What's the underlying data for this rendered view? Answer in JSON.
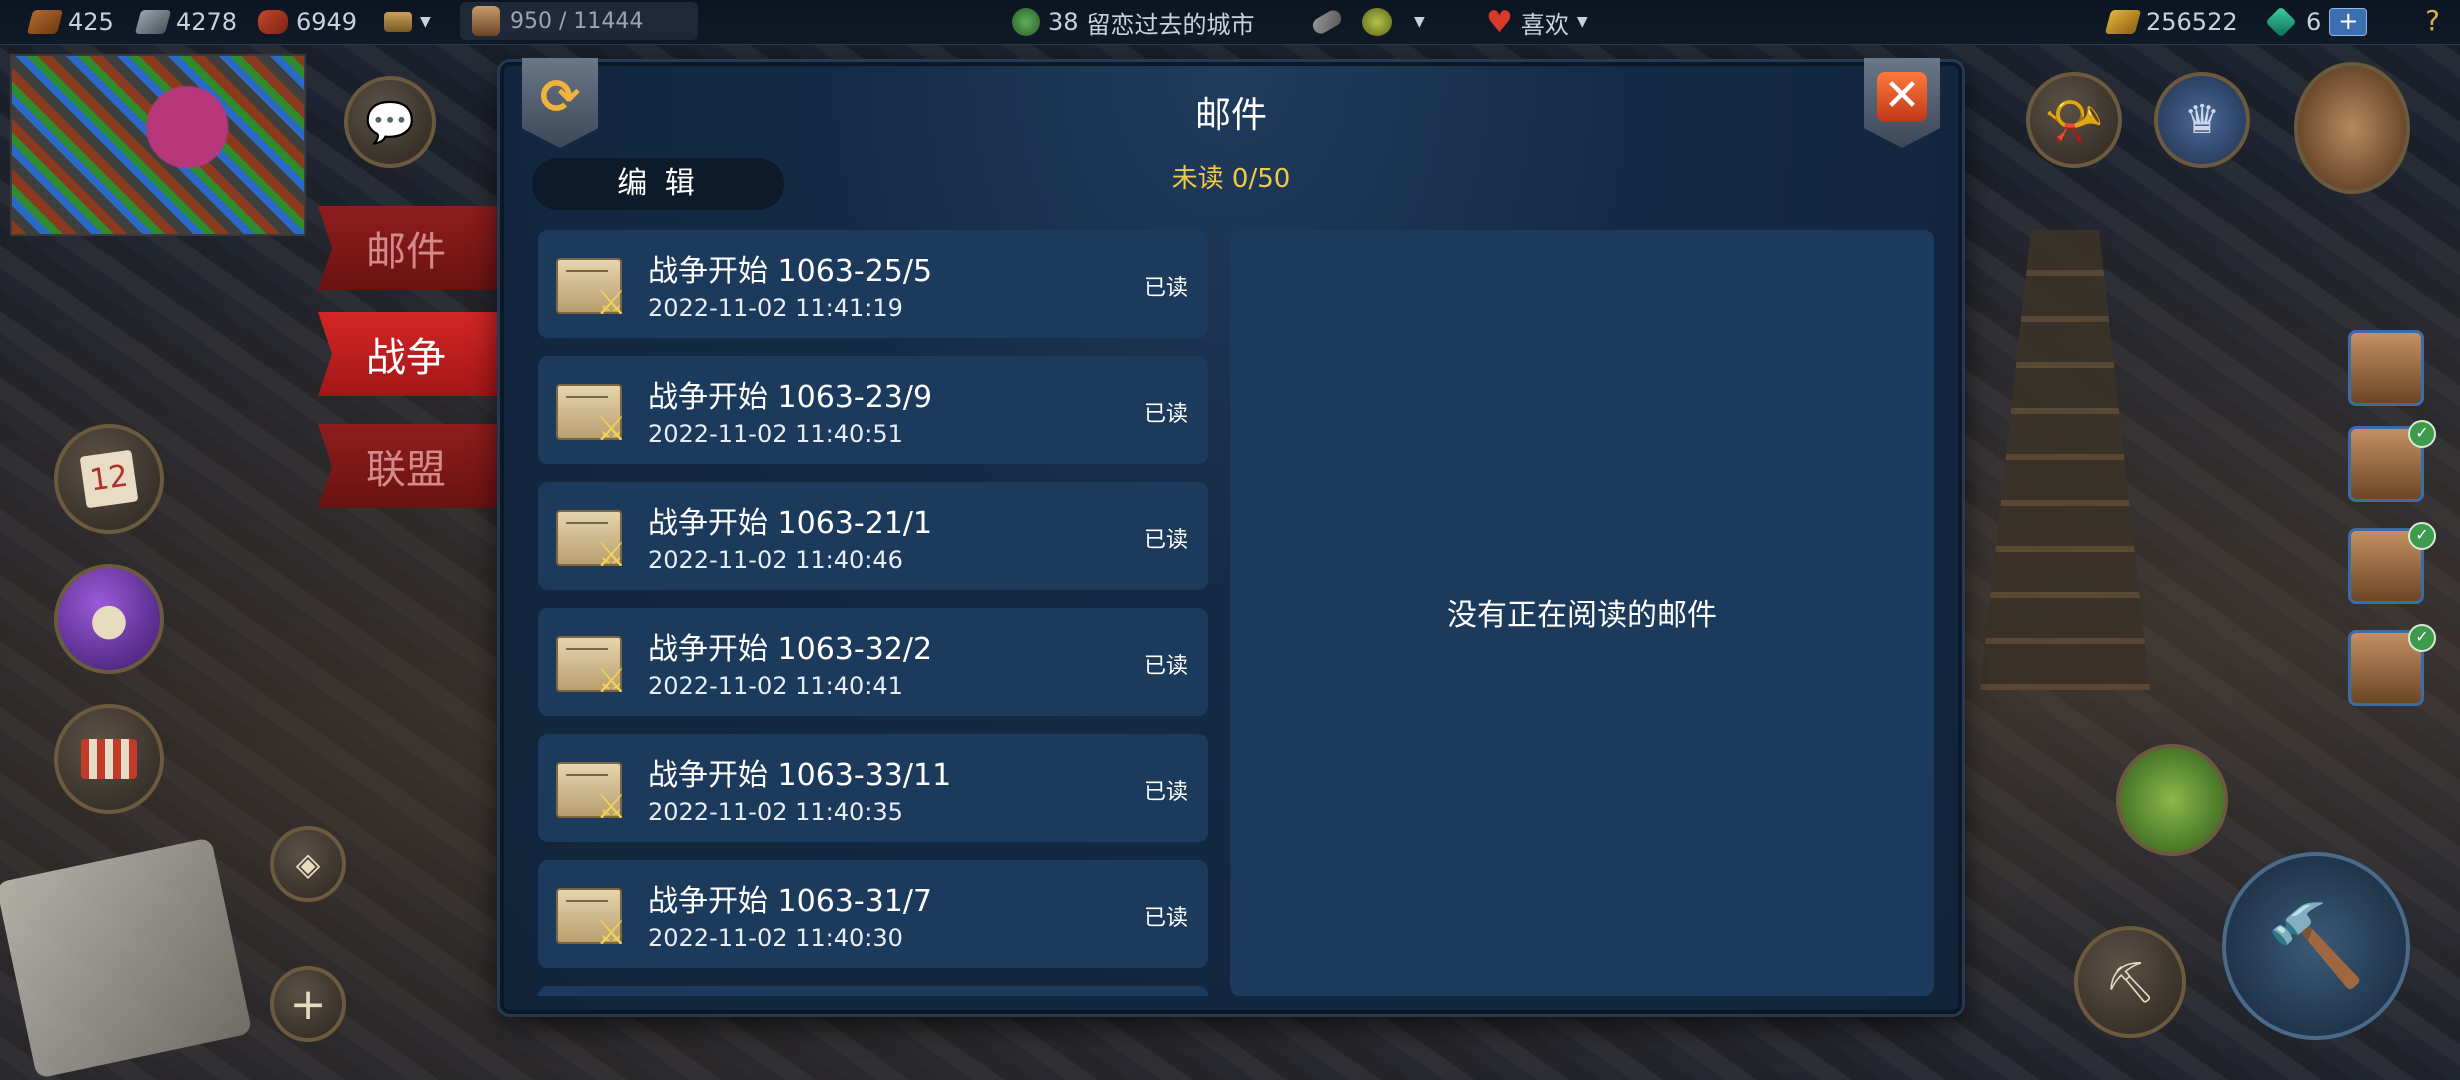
{
  "topbar": {
    "wood": "425",
    "iron": "4278",
    "clay": "6949",
    "population": "950 / 11444",
    "happiness_level": "38",
    "city_name": "留恋过去的城市",
    "mood_label": "喜欢",
    "gold": "256522",
    "gems": "6",
    "plus": "+",
    "help": "?"
  },
  "side_tabs": [
    {
      "label": "邮件",
      "active": false
    },
    {
      "label": "战争",
      "active": true
    },
    {
      "label": "联盟",
      "active": false
    }
  ],
  "hud": {
    "calendar_day": "12",
    "plus_button": "+"
  },
  "dialog": {
    "title": "邮件",
    "unread": "未读 0/50",
    "edit_label": "编 辑",
    "empty_reader": "没有正在阅读的邮件"
  },
  "mails": [
    {
      "title": "战争开始 1063-25/5",
      "date": "2022-11-02 11:41:19",
      "status": "已读"
    },
    {
      "title": "战争开始 1063-23/9",
      "date": "2022-11-02 11:40:51",
      "status": "已读"
    },
    {
      "title": "战争开始 1063-21/1",
      "date": "2022-11-02 11:40:46",
      "status": "已读"
    },
    {
      "title": "战争开始 1063-32/2",
      "date": "2022-11-02 11:40:41",
      "status": "已读"
    },
    {
      "title": "战争开始 1063-33/11",
      "date": "2022-11-02 11:40:35",
      "status": "已读"
    },
    {
      "title": "战争开始 1063-31/7",
      "date": "2022-11-02 11:40:30",
      "status": "已读"
    }
  ],
  "colors": {
    "accent_gold": "#f0c94b",
    "tab_active": "#d52626",
    "panel": "#1c3a5c"
  }
}
